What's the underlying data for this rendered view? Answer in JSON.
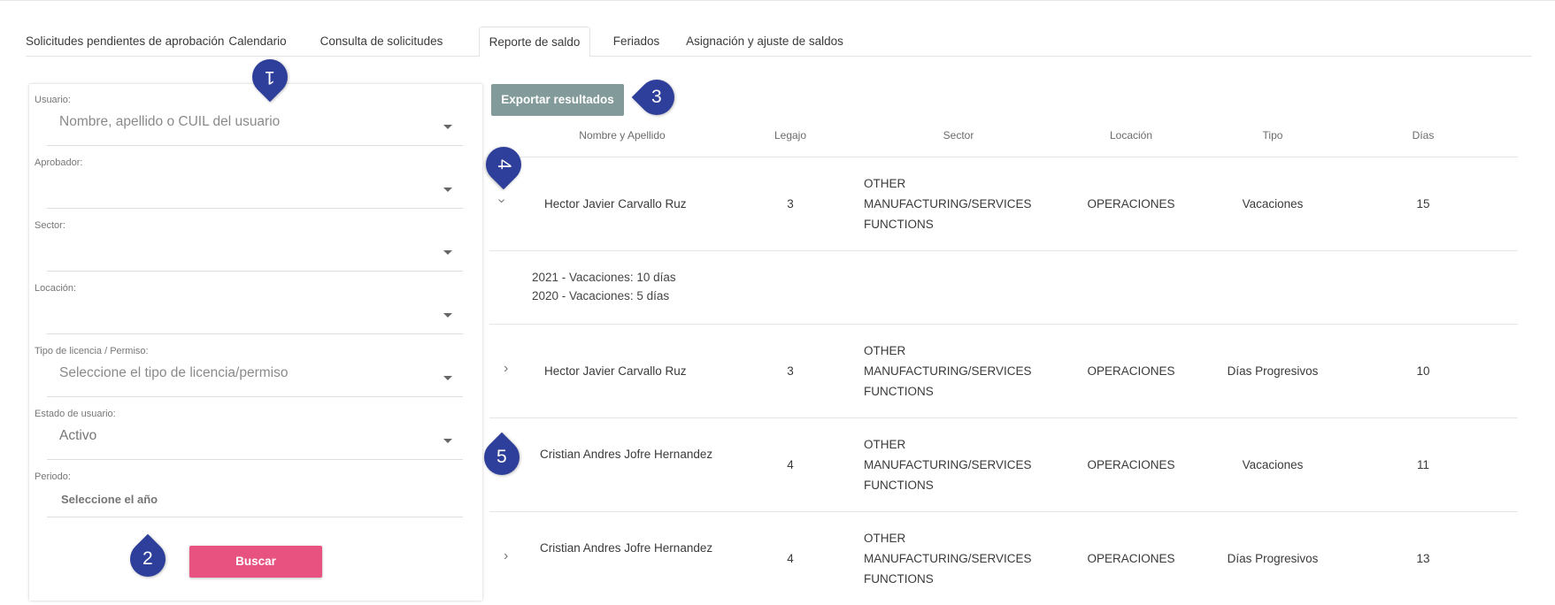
{
  "tabs": [
    {
      "label": "Solicitudes pendientes de aprobación"
    },
    {
      "label": "Calendario"
    },
    {
      "label": "Consulta de solicitudes"
    },
    {
      "label": "Reporte de saldo",
      "active": true
    },
    {
      "label": "Feriados"
    },
    {
      "label": "Asignación y ajuste de saldos"
    }
  ],
  "filters": {
    "usuario": {
      "label": "Usuario:",
      "placeholder": "Nombre, apellido o CUIL del usuario"
    },
    "aprobador": {
      "label": "Aprobador:",
      "value": ""
    },
    "sector": {
      "label": "Sector:",
      "value": ""
    },
    "locacion": {
      "label": "Locación:",
      "value": ""
    },
    "tipo": {
      "label": "Tipo de licencia / Permiso:",
      "placeholder": "Seleccione el tipo de licencia/permiso"
    },
    "estado": {
      "label": "Estado de usuario:",
      "value": "Activo"
    },
    "periodo": {
      "label": "Periodo:",
      "placeholder": "Seleccione el año"
    },
    "search_label": "Buscar"
  },
  "export_label": "Exportar resultados",
  "table": {
    "headers": [
      "Nombre y Apellido",
      "Legajo",
      "Sector",
      "Locación",
      "Tipo",
      "Días"
    ],
    "rows": [
      {
        "name": "Hector Javier Carvallo Ruz",
        "legajo": "3",
        "sector": "OTHER MANUFACTURING/SERVICES FUNCTIONS",
        "locacion": "OPERACIONES",
        "tipo": "Vacaciones",
        "dias": "15",
        "expanded": true,
        "details": [
          "2021 - Vacaciones: 10 días",
          "2020 - Vacaciones: 5 días"
        ]
      },
      {
        "name": "Hector Javier Carvallo Ruz",
        "legajo": "3",
        "sector": "OTHER MANUFACTURING/SERVICES FUNCTIONS",
        "locacion": "OPERACIONES",
        "tipo": "Días Progresivos",
        "dias": "10"
      },
      {
        "name": "Cristian Andres Jofre Hernandez",
        "legajo": "4",
        "sector": "OTHER MANUFACTURING/SERVICES FUNCTIONS",
        "locacion": "OPERACIONES",
        "tipo": "Vacaciones",
        "dias": "11"
      },
      {
        "name": "Cristian Andres Jofre Hernandez",
        "legajo": "4",
        "sector": "OTHER MANUFACTURING/SERVICES FUNCTIONS",
        "locacion": "OPERACIONES",
        "tipo": "Días Progresivos",
        "dias": "13"
      }
    ]
  },
  "markers": [
    "1",
    "2",
    "3",
    "4",
    "5"
  ],
  "colors": {
    "marker": "#2e3f9b",
    "search_button": "#e75280",
    "export_button": "#829a9a"
  },
  "icons": {
    "dropdown": "caret-down-icon",
    "expand": "chevron-right-icon",
    "collapse": "chevron-down-icon"
  }
}
